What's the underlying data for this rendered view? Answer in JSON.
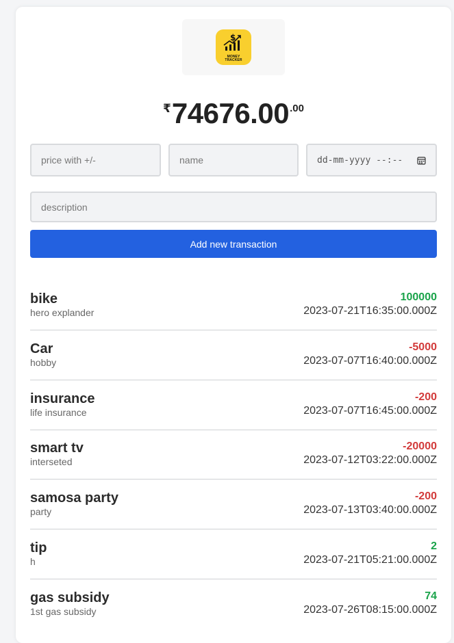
{
  "logo": {
    "line1": "MONEY",
    "line2": "TRACKER"
  },
  "balance": {
    "currency": "₹",
    "whole": "74676.00",
    "decimal": ".00"
  },
  "form": {
    "price_placeholder": "price with +/-",
    "name_placeholder": "name",
    "date_placeholder": "dd-mm-yyyy --:--",
    "description_placeholder": "description",
    "submit_label": "Add new transaction"
  },
  "colors": {
    "positive": "#1aa34a",
    "negative": "#d23a3a",
    "button": "#2361e0"
  },
  "transactions": [
    {
      "name": "bike",
      "description": "hero explander",
      "amount": "100000",
      "datetime": "2023-07-21T16:35:00.000Z",
      "sign": "positive"
    },
    {
      "name": "Car",
      "description": "hobby",
      "amount": "-5000",
      "datetime": "2023-07-07T16:40:00.000Z",
      "sign": "negative"
    },
    {
      "name": "insurance",
      "description": "life insurance",
      "amount": "-200",
      "datetime": "2023-07-07T16:45:00.000Z",
      "sign": "negative"
    },
    {
      "name": "smart tv",
      "description": "interseted",
      "amount": "-20000",
      "datetime": "2023-07-12T03:22:00.000Z",
      "sign": "negative"
    },
    {
      "name": "samosa party",
      "description": "party",
      "amount": "-200",
      "datetime": "2023-07-13T03:40:00.000Z",
      "sign": "negative"
    },
    {
      "name": "tip",
      "description": "h",
      "amount": "2",
      "datetime": "2023-07-21T05:21:00.000Z",
      "sign": "positive"
    },
    {
      "name": "gas subsidy",
      "description": "1st gas subsidy",
      "amount": "74",
      "datetime": "2023-07-26T08:15:00.000Z",
      "sign": "positive"
    }
  ]
}
